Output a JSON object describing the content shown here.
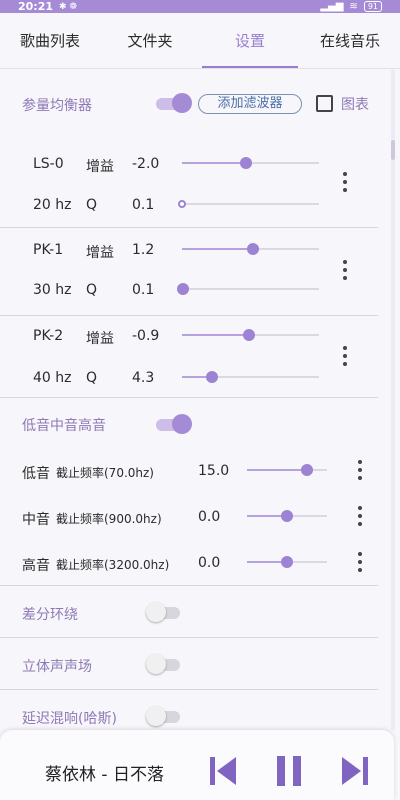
{
  "status": {
    "time": "20:21",
    "battery": "91"
  },
  "tabs": [
    {
      "label": "歌曲列表",
      "active": false
    },
    {
      "label": "文件夹",
      "active": false
    },
    {
      "label": "设置",
      "active": true
    },
    {
      "label": "在线音乐",
      "active": false
    }
  ],
  "equalizer": {
    "title": "参量均衡器",
    "enabled": true,
    "add_filter_label": "添加滤波器",
    "chart_label": "图表",
    "chart_checked": false,
    "filters": [
      {
        "name": "LS-0",
        "freq": "20 hz",
        "gain_label": "增益",
        "gain": "-2.0",
        "gain_pos": 0.47,
        "q_label": "Q",
        "q": "0.1",
        "q_pos": 0.0
      },
      {
        "name": "PK-1",
        "freq": "30 hz",
        "gain_label": "增益",
        "gain": "1.2",
        "gain_pos": 0.52,
        "q_label": "Q",
        "q": "0.1",
        "q_pos": 0.01
      },
      {
        "name": "PK-2",
        "freq": "40 hz",
        "gain_label": "增益",
        "gain": "-0.9",
        "gain_pos": 0.49,
        "q_label": "Q",
        "q": "4.3",
        "q_pos": 0.22
      }
    ]
  },
  "tone": {
    "title": "低音中音高音",
    "enabled": true,
    "bands": [
      {
        "name": "低音",
        "cutoff": "截止频率(70.0hz)",
        "value": "15.0",
        "pos": 0.75
      },
      {
        "name": "中音",
        "cutoff": "截止频率(900.0hz)",
        "value": "0.0",
        "pos": 0.5
      },
      {
        "name": "高音",
        "cutoff": "截止频率(3200.0hz)",
        "value": "0.0",
        "pos": 0.5
      }
    ]
  },
  "toggles": [
    {
      "label": "差分环绕",
      "enabled": false
    },
    {
      "label": "立体声声场",
      "enabled": false
    },
    {
      "label": "延迟混响(哈斯)",
      "enabled": false
    }
  ],
  "player": {
    "song": "蔡依林 - 日不落"
  },
  "colors": {
    "accent": "#a58bd6",
    "status_bar": "#a58bd6",
    "link": "#4a6ea6"
  },
  "icons": [
    "signal-icon",
    "wifi-icon",
    "battery-icon",
    "more-vert-icon",
    "previous-icon",
    "pause-icon",
    "next-icon"
  ]
}
